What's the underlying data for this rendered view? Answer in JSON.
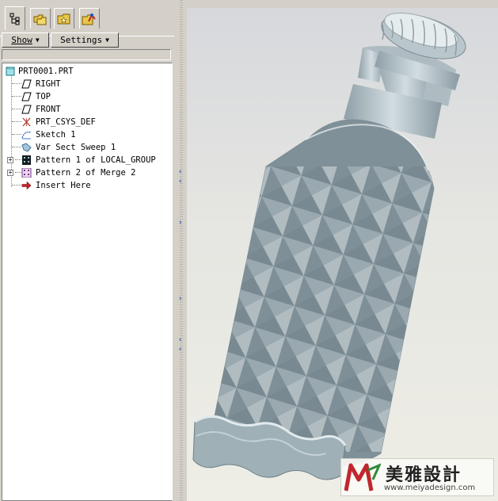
{
  "toolbar": {
    "show_label": "Show",
    "settings_label": "Settings"
  },
  "tabs": [
    {
      "icon": "model-tree-icon"
    },
    {
      "icon": "folder-browser-icon"
    },
    {
      "icon": "favorites-icon"
    },
    {
      "icon": "connections-icon"
    }
  ],
  "tree": {
    "items": [
      {
        "label": "PRT0001.PRT",
        "icon": "part-icon"
      },
      {
        "label": "RIGHT",
        "icon": "datum-plane-icon"
      },
      {
        "label": "TOP",
        "icon": "datum-plane-icon"
      },
      {
        "label": "FRONT",
        "icon": "datum-plane-icon"
      },
      {
        "label": "PRT_CSYS_DEF",
        "icon": "coordinate-system-icon"
      },
      {
        "label": "Sketch 1",
        "icon": "sketch-icon"
      },
      {
        "label": "Var Sect Sweep 1",
        "icon": "sweep-icon"
      },
      {
        "label": "Pattern 1 of LOCAL_GROUP",
        "icon": "pattern-icon"
      },
      {
        "label": "Pattern 2 of Merge 2",
        "icon": "pattern-icon"
      },
      {
        "label": "Insert Here",
        "icon": "insert-arrow-icon"
      }
    ]
  },
  "watermark": {
    "brand": "美雅設計",
    "url": "www.meiyadesign.com"
  },
  "colors": {
    "panel": "#d4d0c8",
    "tree_bg": "#ffffff",
    "bottle": "#b7c4ca",
    "watermark_red": "#c0272d",
    "watermark_green": "#2e8b3a"
  }
}
